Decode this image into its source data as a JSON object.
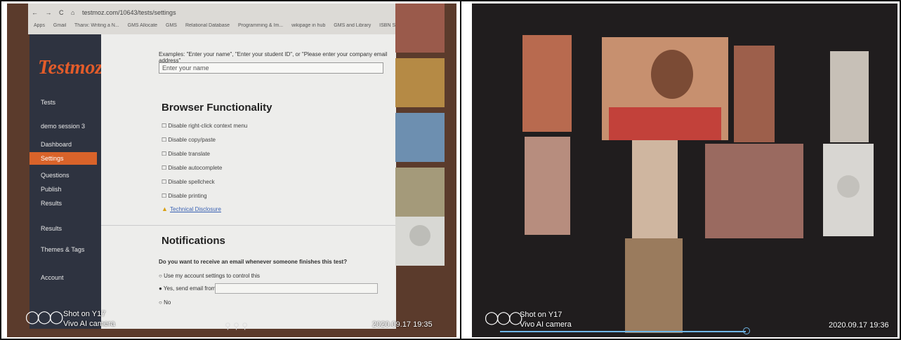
{
  "left_photo": {
    "browser": {
      "url": "testmoz.com/10643/tests/settings",
      "bookmarks": [
        "Apps",
        "Gmail",
        "Thanx: Writing a N...",
        "GMS Allocate",
        "GMS",
        "Relational Database",
        "Programming & Im...",
        "wikipage in hub",
        "GMS and Library",
        "ISBN Scanning Te..."
      ]
    },
    "sidebar": {
      "logo": "Testmoz",
      "items": [
        "Tests",
        "demo session 3",
        "Dashboard",
        "Settings",
        "Questions",
        "Publish",
        "Results",
        "Results",
        "Themes & Tags",
        "Account"
      ]
    },
    "content": {
      "examples_text": "Examples: \"Enter your name\", \"Enter your student ID\", or \"Please enter your company email address\"",
      "name_placeholder": "Enter your name",
      "browser_functionality_heading": "Browser Functionality",
      "options": [
        "Disable right-click context menu",
        "Disable copy/paste",
        "Disable translate",
        "Disable autocomplete",
        "Disable spellcheck",
        "Disable printing"
      ],
      "technical_link": "Technical Disclosure",
      "notifications_heading": "Notifications",
      "notification_question": "Do you want to receive an email whenever someone finishes this test?",
      "notify_option_1": "Use my account settings to control this",
      "notify_option_2": "Yes, send email from to",
      "notify_option_3": "No"
    },
    "overlay": {
      "shot_on": "Shot on Y17",
      "camera": "Vivo AI camera",
      "timestamp": "2020.09.17 19:35"
    }
  },
  "right_photo": {
    "overlay": {
      "shot_on": "Shot on Y17",
      "camera": "Vivo AI camera",
      "timestamp": "2020.09.17 19:36"
    }
  },
  "colors": {
    "sidebar": "#2e3340",
    "brand_orange": "#e35c2a",
    "video_bg": "#201d1e",
    "progress": "#6fb7e8"
  }
}
